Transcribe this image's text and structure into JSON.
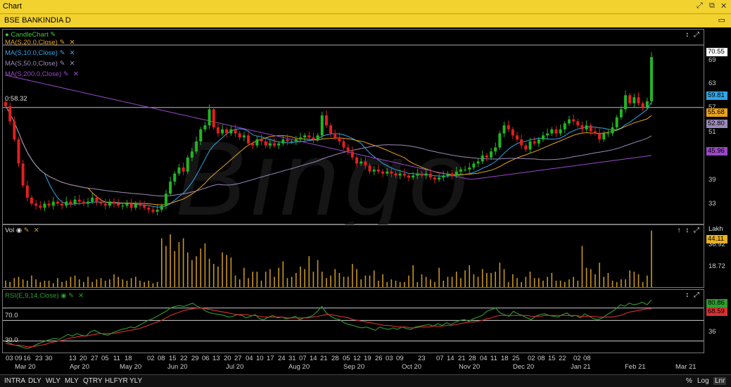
{
  "window": {
    "title": "Chart",
    "controls": [
      "⤢",
      "⧉",
      "✕"
    ]
  },
  "chart_header": {
    "title": "BSE BANKINDIA D",
    "control": "▭"
  },
  "candle_panel": {
    "legend": [
      {
        "label": "CandleChart",
        "color": "#3ec43e"
      },
      {
        "label": "MA(S,20.0,Close)",
        "color": "#e8a21e"
      },
      {
        "label": "MA(S,10.0,Close)",
        "color": "#2fa6e8"
      },
      {
        "label": "MA(S,50.0,Close)",
        "color": "#9a8ab8"
      },
      {
        "label": "MA(S,200.0,Close)",
        "color": "#9a47c9"
      }
    ],
    "price_label": "70.55",
    "crosshair_label": "0:58.32",
    "value_tags": [
      {
        "value": "59.81",
        "color": "#2fa6e8"
      },
      {
        "value": "55.68",
        "color": "#e8a21e"
      },
      {
        "value": "52.80",
        "color": "#9a8ab8"
      },
      {
        "value": "45.96",
        "color": "#9a47c9"
      }
    ],
    "controls": "↕ ⤢"
  },
  "vol_panel": {
    "legend": "Vol",
    "unit": "Lakh",
    "value_tag": "44.11",
    "controls": "↑ ↕ ⤢"
  },
  "rsi_panel": {
    "legend": "RSI(E,9,14,Close)",
    "levels": [
      "70.0",
      "30.0"
    ],
    "value_tags": [
      {
        "value": "80.86",
        "color": "#2f9e2f"
      },
      {
        "value": "68.59",
        "color": "#d83030"
      }
    ],
    "controls": "↕ ⤢"
  },
  "date_axis": {
    "days": [
      "03",
      "09",
      "16",
      "23",
      "30",
      "13",
      "20",
      "27",
      "05",
      "11",
      "18",
      "02",
      "08",
      "15",
      "22",
      "29",
      "06",
      "13",
      "20",
      "27",
      "04",
      "10",
      "17",
      "24",
      "31",
      "07",
      "14",
      "21",
      "28",
      "05",
      "12",
      "19",
      "26",
      "03",
      "09",
      "23",
      "07",
      "14",
      "21",
      "28",
      "04",
      "11",
      "18",
      "25",
      "02",
      "08",
      "15",
      "22",
      "02",
      "08"
    ],
    "months": [
      "Mar 20",
      "Apr 20",
      "May 20",
      "Jun 20",
      "Jul 20",
      "Aug 20",
      "Sep 20",
      "Oct 20",
      "Nov 20",
      "Dec 20",
      "Jan 21",
      "Feb 21",
      "Mar 21"
    ]
  },
  "bottom_bar": {
    "periods": [
      "INTRA",
      "DLY",
      "WLY",
      "MLY",
      "QTRY",
      "HLFYR",
      "YLY"
    ],
    "right": [
      "%",
      "Log",
      "Lnr"
    ]
  },
  "watermark": "Bingo",
  "chart_data": [
    {
      "type": "candlestick",
      "y_ticks": [
        69.0,
        63.0,
        57.0,
        51.0,
        45.0,
        39.0,
        33.0
      ],
      "ylim": [
        29.0,
        73.5
      ],
      "closes": [
        58.3,
        54.5,
        50.0,
        44.0,
        38.5,
        35.5,
        34.0,
        33.5,
        33.0,
        34.0,
        33.5,
        34.5,
        34.0,
        33.5,
        34.5,
        34.0,
        35.0,
        34.5,
        34.0,
        34.5,
        35.5,
        34.5,
        34.0,
        33.5,
        34.5,
        34.0,
        33.5,
        33.5,
        34.0,
        33.0,
        34.0,
        33.5,
        33.0,
        32.5,
        32.0,
        32.5,
        33.5,
        36.5,
        39.5,
        41.5,
        43.0,
        42.0,
        45.5,
        47.0,
        49.5,
        52.5,
        53.5,
        57.5,
        53.0,
        51.5,
        52.5,
        51.5,
        52.5,
        51.5,
        50.5,
        51.0,
        49.0,
        48.5,
        50.0,
        49.5,
        48.5,
        49.0,
        48.5,
        49.0,
        50.0,
        49.5,
        49.5,
        50.0,
        50.5,
        51.0,
        50.5,
        50.0,
        51.0,
        56.0,
        53.5,
        51.5,
        50.5,
        49.5,
        48.0,
        47.0,
        45.5,
        44.0,
        44.5,
        43.5,
        42.0,
        42.5,
        42.0,
        41.5,
        42.0,
        41.5,
        41.0,
        41.5,
        41.0,
        40.5,
        41.0,
        41.5,
        41.0,
        41.5,
        40.5,
        40.0,
        40.5,
        41.0,
        41.5,
        41.0,
        42.0,
        42.5,
        42.5,
        43.0,
        44.0,
        44.5,
        46.0,
        45.5,
        47.0,
        48.0,
        51.5,
        53.5,
        52.5,
        51.0,
        50.0,
        48.5,
        47.5,
        49.5,
        49.0,
        50.0,
        51.0,
        51.5,
        52.5,
        51.5,
        52.5,
        54.0,
        55.0,
        54.5,
        53.5,
        52.5,
        53.5,
        52.0,
        51.5,
        50.0,
        51.5,
        51.5,
        53.0,
        55.5,
        57.5,
        61.0,
        59.0,
        60.5,
        59.0,
        58.0,
        59.5,
        70.5
      ],
      "ma_series": [
        {
          "name": "MA(S,10.0,Close)",
          "color": "#2fa6e8"
        },
        {
          "name": "MA(S,20.0,Close)",
          "color": "#e8a21e"
        },
        {
          "name": "MA(S,50.0,Close)",
          "color": "#9a8ab8"
        },
        {
          "name": "MA(S,200.0,Close)",
          "color": "#9a47c9"
        }
      ]
    },
    {
      "type": "bar",
      "title": "Vol",
      "y_ticks": [
        36.92,
        18.72
      ],
      "ylim": [
        0,
        46
      ],
      "values": [
        5,
        4,
        7,
        8,
        6,
        5,
        9,
        6,
        4,
        5,
        5,
        3,
        7,
        4,
        5,
        8,
        9,
        6,
        4,
        8,
        4,
        6,
        7,
        5,
        6,
        10,
        8,
        6,
        5,
        7,
        8,
        5,
        4,
        5,
        3,
        4,
        38,
        32,
        41,
        28,
        35,
        38,
        27,
        21,
        24,
        30,
        34,
        22,
        18,
        16,
        27,
        25,
        23,
        9,
        6,
        15,
        7,
        12,
        12,
        5,
        12,
        14,
        8,
        15,
        20,
        7,
        8,
        11,
        16,
        14,
        24,
        12,
        21,
        12,
        7,
        9,
        14,
        11,
        8,
        8,
        18,
        14,
        6,
        9,
        9,
        13,
        5,
        10,
        4,
        6,
        5,
        4,
        4,
        9,
        17,
        4,
        10,
        8,
        6,
        4,
        15,
        5,
        8,
        8,
        12,
        7,
        13,
        17,
        10,
        8,
        14,
        11,
        11,
        12,
        19,
        14,
        4,
        10,
        7,
        4,
        8,
        12,
        7,
        7,
        5,
        8,
        11,
        5,
        5,
        4,
        6,
        8,
        5,
        32,
        15,
        14,
        10,
        19,
        8,
        11,
        5,
        4,
        6,
        6,
        13,
        12,
        10,
        4,
        9,
        44
      ]
    },
    {
      "type": "line",
      "title": "RSI(E,9,14,Close)",
      "y_ticks": [
        70.0,
        36.0,
        30.0
      ],
      "ylim": [
        16,
        92
      ],
      "series": [
        {
          "name": "RSI",
          "color": "#2f9e2f",
          "values": [
            30,
            27,
            25,
            24,
            22,
            21,
            23,
            26,
            28,
            30,
            32,
            33,
            32,
            35,
            38,
            36,
            39,
            37,
            36,
            41,
            43,
            40,
            38,
            37,
            40,
            42,
            44,
            45,
            47,
            46,
            49,
            52,
            55,
            57,
            60,
            63,
            66,
            70,
            72,
            73,
            72,
            74,
            76,
            72,
            70,
            66,
            64,
            63,
            62,
            61,
            59,
            60,
            62,
            61,
            58,
            60,
            62,
            57,
            56,
            59,
            61,
            58,
            59,
            57,
            58,
            60,
            56,
            58,
            59,
            61,
            66,
            72,
            64,
            60,
            57,
            56,
            52,
            50,
            49,
            47,
            46,
            47,
            45,
            43,
            47,
            45,
            44,
            46,
            44,
            47,
            45,
            44,
            47,
            48,
            49,
            50,
            48,
            51,
            49,
            52,
            50,
            53,
            55,
            56,
            54,
            57,
            59,
            61,
            66,
            68,
            70,
            64,
            62,
            60,
            66,
            63,
            61,
            58,
            56,
            60,
            62,
            63,
            61,
            60,
            59,
            62,
            64,
            60,
            61,
            58,
            63,
            60,
            57,
            56,
            58,
            62,
            65,
            69,
            74,
            72,
            76,
            74,
            75,
            77,
            74,
            80
          ]
        },
        {
          "name": "Signal",
          "color": "#d83030",
          "values": [
            27,
            26,
            25,
            25,
            24,
            23,
            23,
            24,
            25,
            26,
            28,
            29,
            30,
            31,
            33,
            34,
            35,
            36,
            36,
            37,
            38,
            39,
            39,
            39,
            39,
            40,
            41,
            42,
            43,
            44,
            45,
            47,
            49,
            51,
            53,
            55,
            58,
            61,
            63,
            65,
            67,
            68,
            69,
            70,
            70,
            69,
            68,
            67,
            66,
            65,
            64,
            63,
            62,
            62,
            62,
            61,
            61,
            60,
            59,
            59,
            59,
            59,
            59,
            58,
            58,
            58,
            58,
            58,
            58,
            59,
            60,
            61,
            62,
            62,
            61,
            60,
            59,
            58,
            56,
            55,
            54,
            53,
            52,
            51,
            50,
            49,
            49,
            48,
            47,
            47,
            47,
            46,
            46,
            47,
            47,
            47,
            48,
            48,
            48,
            49,
            49,
            50,
            51,
            52,
            53,
            53,
            54,
            55,
            57,
            58,
            60,
            61,
            61,
            61,
            61,
            61,
            61,
            61,
            60,
            60,
            60,
            61,
            61,
            61,
            61,
            61,
            61,
            61,
            61,
            60,
            60,
            60,
            60,
            59,
            59,
            59,
            59,
            60,
            61,
            63,
            65,
            66,
            67,
            68,
            69,
            69
          ]
        }
      ]
    }
  ]
}
